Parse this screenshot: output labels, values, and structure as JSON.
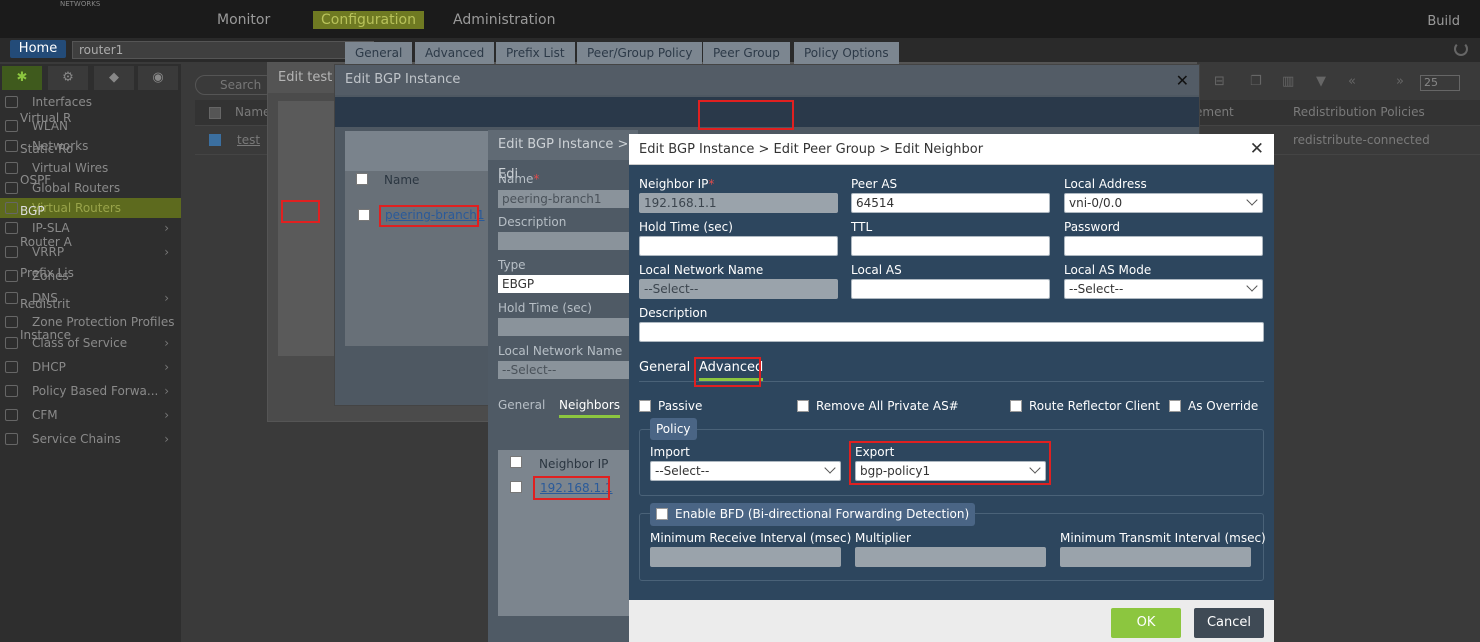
{
  "topnav": {
    "logo_text": "NETWORKS",
    "tabs": [
      "Monitor",
      "Configuration",
      "Administration"
    ],
    "build": "Build"
  },
  "context_bar": {
    "home": "Home",
    "device": "router1"
  },
  "sidebar": {
    "items": [
      {
        "label": "Interfaces",
        "icon": "interfaces-icon"
      },
      {
        "label": "WLAN",
        "icon": "wifi-icon"
      },
      {
        "label": "Networks",
        "icon": "network-icon"
      },
      {
        "label": "Virtual Wires",
        "icon": "wire-icon"
      },
      {
        "label": "Global Routers",
        "icon": "router-icon"
      },
      {
        "label": "Virtual Routers",
        "icon": "router-icon"
      },
      {
        "label": "IP-SLA",
        "icon": "sla-icon"
      },
      {
        "label": "VRRP",
        "icon": "vrrp-icon"
      },
      {
        "label": "Zones",
        "icon": "globe-icon"
      },
      {
        "label": "DNS",
        "icon": "globe-icon"
      },
      {
        "label": "Zone Protection Profiles",
        "icon": "shield-icon"
      },
      {
        "label": "Class of Service",
        "icon": "cos-icon"
      },
      {
        "label": "DHCP",
        "icon": "dhcp-icon"
      },
      {
        "label": "Policy Based Forwa...",
        "icon": "pbf-icon"
      },
      {
        "label": "CFM",
        "icon": "cfm-icon"
      },
      {
        "label": "Service Chains",
        "icon": "gear-icon"
      }
    ]
  },
  "background_table": {
    "search_placeholder": "Search",
    "columns": [
      "Name",
      "ement",
      "Redistribution Policies"
    ],
    "rows": [
      {
        "name": "test",
        "redistribution": "redistribute-connected"
      }
    ],
    "page_size": "25"
  },
  "dlg_test": {
    "title": "Edit test",
    "items": [
      "Virtual R",
      "Static Ro",
      "OSPF",
      "BGP",
      "Router A",
      "Prefix Lis",
      "Redistrit",
      "Instance"
    ]
  },
  "dlg_bgp": {
    "title": "Edit BGP Instance",
    "tabs": [
      "General",
      "Advanced",
      "Prefix List",
      "Peer/Group Policy",
      "Peer Group",
      "Policy Options"
    ],
    "table_header": "Name",
    "row": "peering-branch1"
  },
  "dlg_peergroup": {
    "title": "Edit BGP Instance > Edi",
    "name_label": "Name",
    "name_value": "peering-branch1",
    "description_label": "Description",
    "type_label": "Type",
    "type_value": "EBGP",
    "hold_label": "Hold Time (sec)",
    "local_net_label": "Local Network Name",
    "local_net_value": "--Select--",
    "tabs": [
      "General",
      "Neighbors"
    ],
    "table_header": "Neighbor IP",
    "row": "192.168.1.1"
  },
  "neighbor": {
    "title": "Edit BGP Instance > Edit Peer Group > Edit Neighbor",
    "fields": {
      "neighbor_ip": {
        "label": "Neighbor IP",
        "value": "192.168.1.1"
      },
      "peer_as": {
        "label": "Peer AS",
        "value": "64514"
      },
      "local_address": {
        "label": "Local Address",
        "value": "vni-0/0.0"
      },
      "hold_time": {
        "label": "Hold Time (sec)",
        "value": ""
      },
      "ttl": {
        "label": "TTL",
        "value": ""
      },
      "password": {
        "label": "Password",
        "value": ""
      },
      "local_network_name": {
        "label": "Local Network Name",
        "value": "--Select--"
      },
      "local_as": {
        "label": "Local AS",
        "value": ""
      },
      "local_as_mode": {
        "label": "Local AS Mode",
        "value": "--Select--"
      },
      "description": {
        "label": "Description",
        "value": ""
      }
    },
    "tabs": [
      "General",
      "Advanced"
    ],
    "checkboxes": [
      "Passive",
      "Remove All Private AS#",
      "Route Reflector Client",
      "As Override"
    ],
    "policy": {
      "legend": "Policy",
      "import_label": "Import",
      "import_value": "--Select--",
      "export_label": "Export",
      "export_value": "bgp-policy1"
    },
    "bfd": {
      "legend": "Enable BFD (Bi-directional Forwarding Detection)",
      "min_rx_label": "Minimum Receive Interval (msec)",
      "multiplier_label": "Multiplier",
      "min_tx_label": "Minimum Transmit Interval (msec)"
    },
    "ok": "OK",
    "cancel": "Cancel"
  }
}
